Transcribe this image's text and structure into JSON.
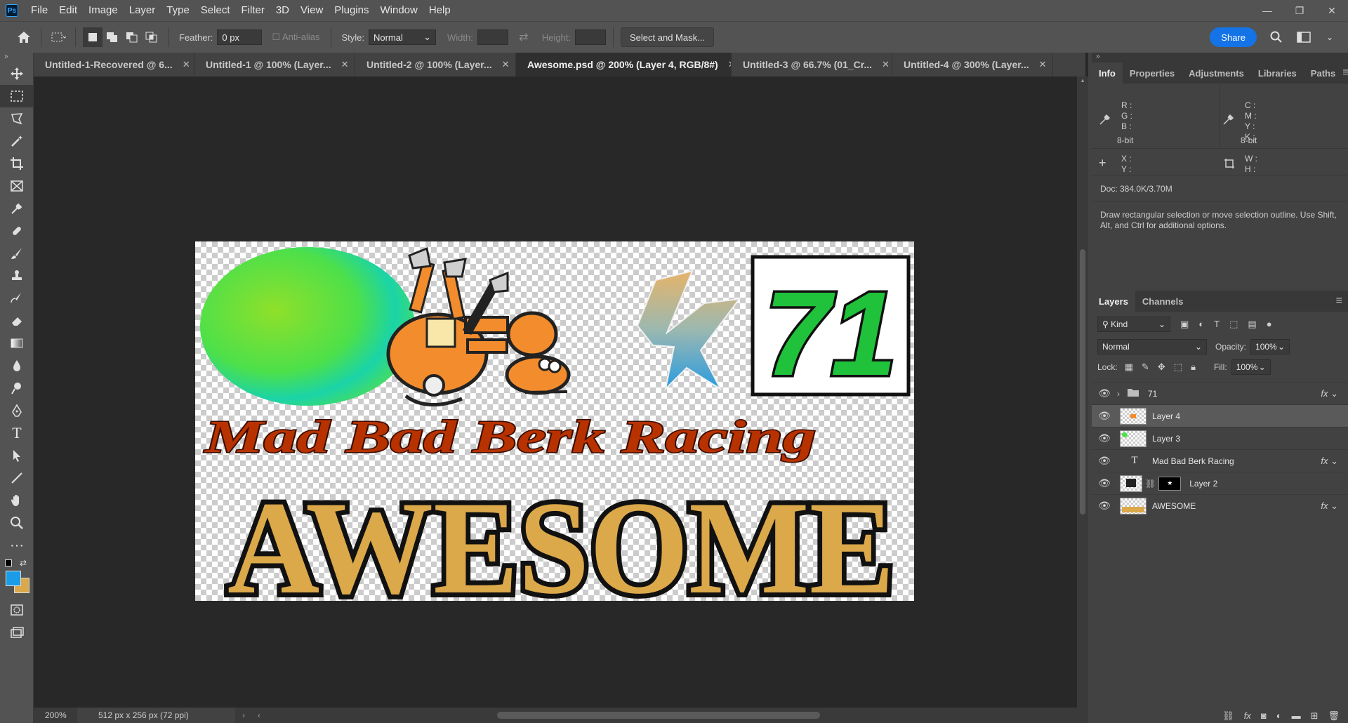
{
  "app": {
    "logo": "Ps"
  },
  "menu": [
    "File",
    "Edit",
    "Image",
    "Layer",
    "Type",
    "Select",
    "Filter",
    "3D",
    "View",
    "Plugins",
    "Window",
    "Help"
  ],
  "window_controls": [
    "—",
    "❐",
    "✕"
  ],
  "options": {
    "feather_label": "Feather:",
    "feather_value": "0 px",
    "antialias_label": "Anti-alias",
    "style_label": "Style:",
    "style_value": "Normal",
    "width_label": "Width:",
    "height_label": "Height:",
    "select_mask_label": "Select and Mask...",
    "share_label": "Share"
  },
  "tabs": [
    {
      "label": "Untitled-1-Recovered @ 6...",
      "active": false
    },
    {
      "label": "Untitled-1 @ 100% (Layer...",
      "active": false
    },
    {
      "label": "Untitled-2 @ 100% (Layer...",
      "active": false
    },
    {
      "label": "Awesome.psd @ 200% (Layer 4, RGB/8#)",
      "active": true
    },
    {
      "label": "Untitled-3 @ 66.7% (01_Cr...",
      "active": false
    },
    {
      "label": "Untitled-4 @ 300% (Layer...",
      "active": false
    }
  ],
  "artwork": {
    "number": "71",
    "racing_text": "Mad Bad Berk Racing",
    "big_text": "AWESOME",
    "colors": {
      "racing": "#b83200",
      "awesome": "#dba84a",
      "number": "#1fc23a",
      "oval_a": "#7be03a",
      "oval_b": "#18d2a8"
    }
  },
  "status": {
    "zoom": "200%",
    "doc_info": "512 px x 256 px (72 ppi)"
  },
  "panels": {
    "top_tabs": [
      "Info",
      "Properties",
      "Adjustments",
      "Libraries",
      "Paths"
    ],
    "info": {
      "rgb": [
        "R :",
        "G :",
        "B :"
      ],
      "cmyk": [
        "C :",
        "M :",
        "Y :",
        "K :"
      ],
      "bit_left": "8-bit",
      "bit_right": "8-bit",
      "xy": [
        "X :",
        "Y :"
      ],
      "wh": [
        "W :",
        "H :"
      ],
      "doc": "Doc: 384.0K/3.70M",
      "hint": "Draw rectangular selection or move selection outline.  Use Shift, Alt, and Ctrl for additional options."
    },
    "layer_tabs": [
      "Layers",
      "Channels"
    ],
    "kind_label": "Kind",
    "blend_mode": "Normal",
    "opacity_label": "Opacity:",
    "opacity_value": "100%",
    "lock_label": "Lock:",
    "fill_label": "Fill:",
    "fill_value": "100%",
    "layers": [
      {
        "name": "71",
        "type": "group",
        "fx": true,
        "selected": false
      },
      {
        "name": "Layer 4",
        "type": "pixel",
        "fx": false,
        "selected": true
      },
      {
        "name": "Layer 3",
        "type": "pixel",
        "fx": false,
        "selected": false
      },
      {
        "name": "Mad Bad Berk Racing",
        "type": "text",
        "fx": true,
        "selected": false
      },
      {
        "name": "Layer 2",
        "type": "masked",
        "fx": false,
        "selected": false
      },
      {
        "name": "AWESOME",
        "type": "pixel",
        "fx": true,
        "selected": false
      }
    ]
  }
}
